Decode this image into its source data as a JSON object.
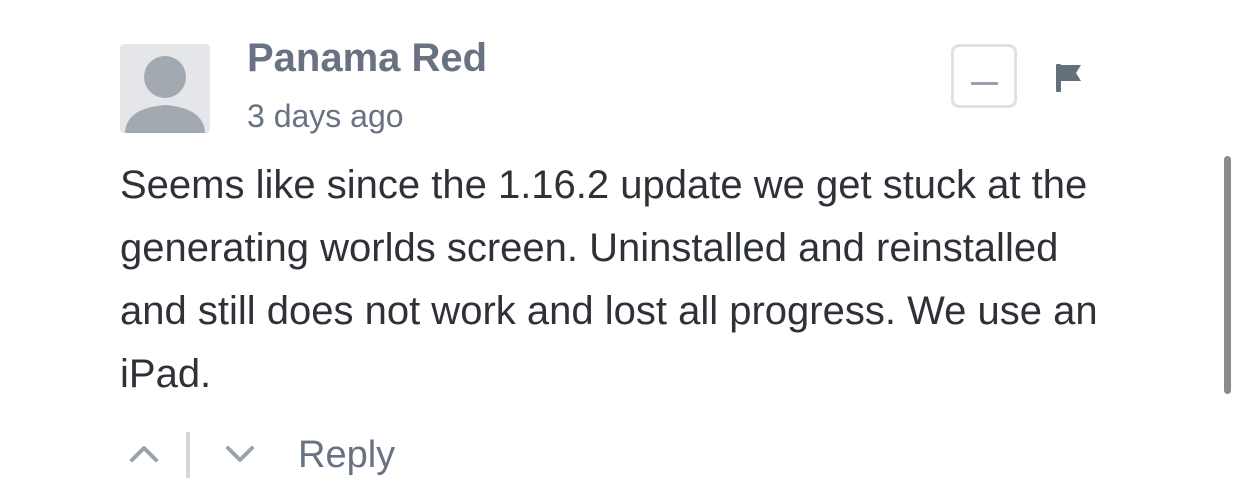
{
  "comment": {
    "author": "Panama Red",
    "timestamp": "3 days ago",
    "body": "Seems like since the 1.16.2 update we get stuck at the generating worlds screen. Uninstalled and reinstalled and still does not work and lost all progress. We use an iPad."
  },
  "actions": {
    "reply_label": "Reply",
    "collapse_icon": "minus-icon",
    "flag_icon": "flag-icon",
    "upvote_icon": "chevron-up-icon",
    "downvote_icon": "chevron-down-icon"
  },
  "colors": {
    "author_text": "#687282",
    "body_text": "#2e3238",
    "icon_gray": "#9aa2ad",
    "flag_dark": "#656e7b",
    "avatar_bg": "#e4e6e9",
    "avatar_figure": "#a3a9b1"
  }
}
